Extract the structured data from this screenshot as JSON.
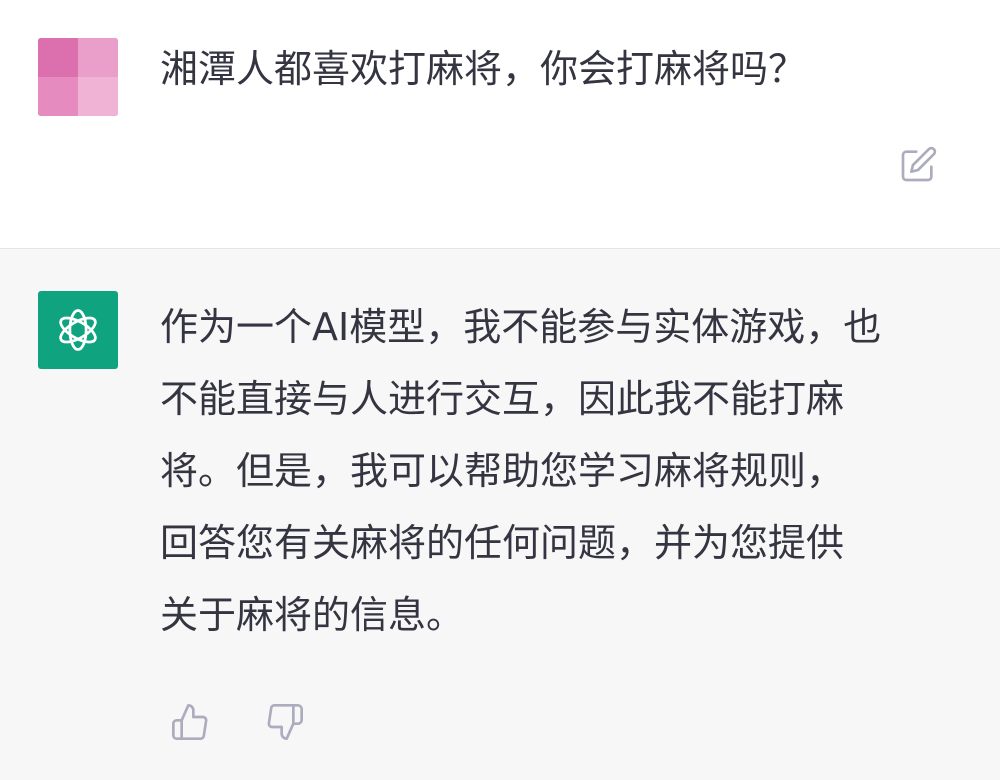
{
  "user_message": {
    "avatar": "blurred-user-avatar",
    "text": "湘潭人都喜欢打麻将，你会打麻将吗？",
    "edit_icon": "edit-icon"
  },
  "assistant_message": {
    "avatar": "openai-logo-icon",
    "lines": [
      "作为一个AI模型，我不能参与实体游戏，也",
      "不能直接与人进行交互，因此我不能打麻",
      "将。但是，我可以帮助您学习麻将规则，",
      "回答您有关麻将的任何问题，并为您提供",
      "关于麻将的信息。"
    ],
    "feedback": {
      "thumbs_up_icon": "thumbs-up-icon",
      "thumbs_down_icon": "thumbs-down-icon"
    }
  },
  "colors": {
    "user_bg": "#ffffff",
    "assistant_bg": "#f7f7f8",
    "text": "#343541",
    "icon": "#acacbe",
    "brand": "#10a37f",
    "avatar_pink": "#e277b4"
  }
}
